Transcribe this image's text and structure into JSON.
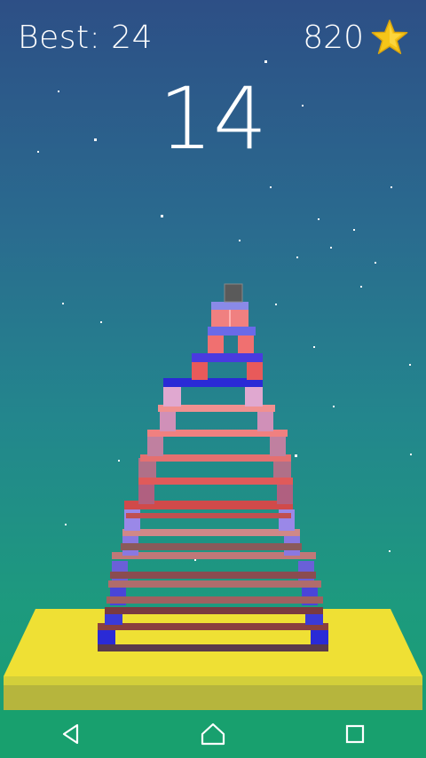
{
  "hud": {
    "best_label": "Best: 24",
    "coins": "820",
    "score": "14",
    "star_icon": "star-icon",
    "star_color": "#f5c518"
  },
  "colors": {
    "platform_top": "#efe034",
    "platform_side": "#b9b43e",
    "cube": "#595959"
  },
  "navbar": {
    "back_icon": "back-triangle-icon",
    "home_icon": "home-icon",
    "recents_icon": "recents-square-icon"
  }
}
